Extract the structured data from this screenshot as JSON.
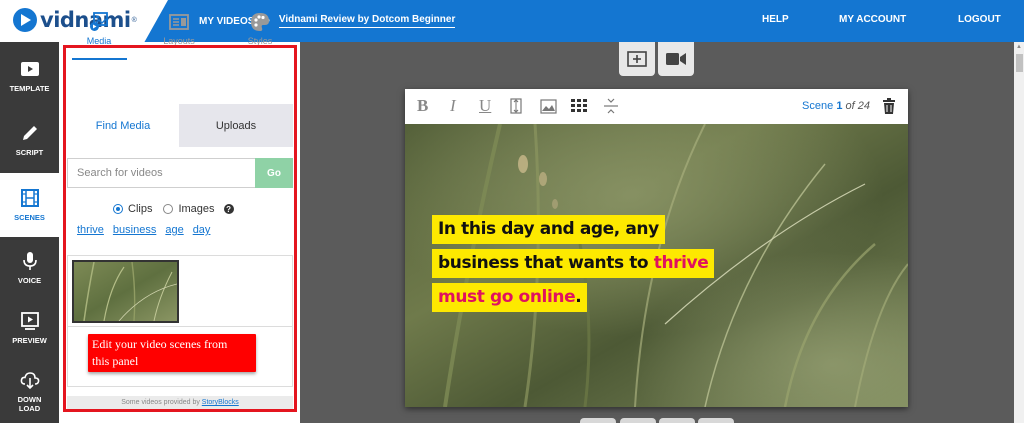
{
  "brand": {
    "name": "vidnami",
    "reg": "®"
  },
  "breadcrumb": {
    "root": "MY VIDEOS",
    "separator": ">",
    "current": "Vidnami Review by Dotcom Beginner"
  },
  "topnav": {
    "help": "HELP",
    "account": "MY ACCOUNT",
    "logout": "LOGOUT"
  },
  "rail": {
    "template": "TEMPLATE",
    "script": "SCRIPT",
    "scenes": "SCENES",
    "voice": "VOICE",
    "preview": "PREVIEW",
    "download_1": "DOWN",
    "download_2": "LOAD"
  },
  "panel": {
    "tabs": {
      "media": "Media",
      "layouts": "Layouts",
      "styles": "Styles"
    },
    "subtabs": {
      "find": "Find Media",
      "uploads": "Uploads"
    },
    "search": {
      "placeholder": "Search for videos",
      "value": "",
      "go": "Go"
    },
    "filter": {
      "clips": "Clips",
      "images": "Images",
      "help": "?",
      "selected": "Clips"
    },
    "tags": [
      "thrive",
      "business",
      "age",
      "day"
    ],
    "callout_1": "Edit your video scenes from",
    "callout_2": "this panel",
    "provided_prefix": "Some videos provided by",
    "provided_link": "StoryBlocks"
  },
  "editor": {
    "toolbar": {
      "bold": "B",
      "italic": "I",
      "underline": "U"
    },
    "scene": {
      "label": "Scene",
      "current": "1",
      "of": "of",
      "total": "24"
    },
    "caption": {
      "line1": "In this day and age, any",
      "line2_a": "business that wants to ",
      "line2_b": "thrive",
      "line3_a": "must go online",
      "line3_b": "."
    }
  },
  "colors": {
    "brand_blue": "#1476d1",
    "highlight_yellow": "#fde900",
    "highlight_pink": "#e0115f",
    "callout_red": "#ff0000",
    "go_green": "#8fd2a6"
  }
}
